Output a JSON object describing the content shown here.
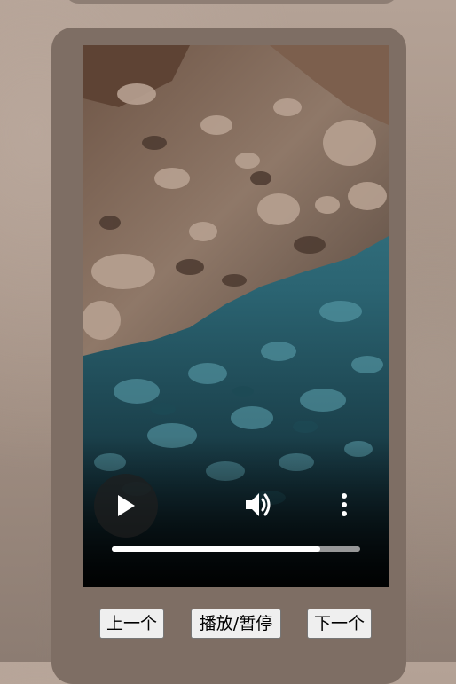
{
  "player": {
    "controls": {
      "play_icon": "play-icon",
      "volume_icon": "volume-icon",
      "more_icon": "more-vertical-icon",
      "progress": 0.84
    }
  },
  "buttons": {
    "prev_label": "上一个",
    "toggle_label": "播放/暂停",
    "next_label": "下一个"
  },
  "colors": {
    "water": "#2f6b78",
    "rock": "#8d7665",
    "card": "#7e6e64",
    "background": "#a89588"
  }
}
